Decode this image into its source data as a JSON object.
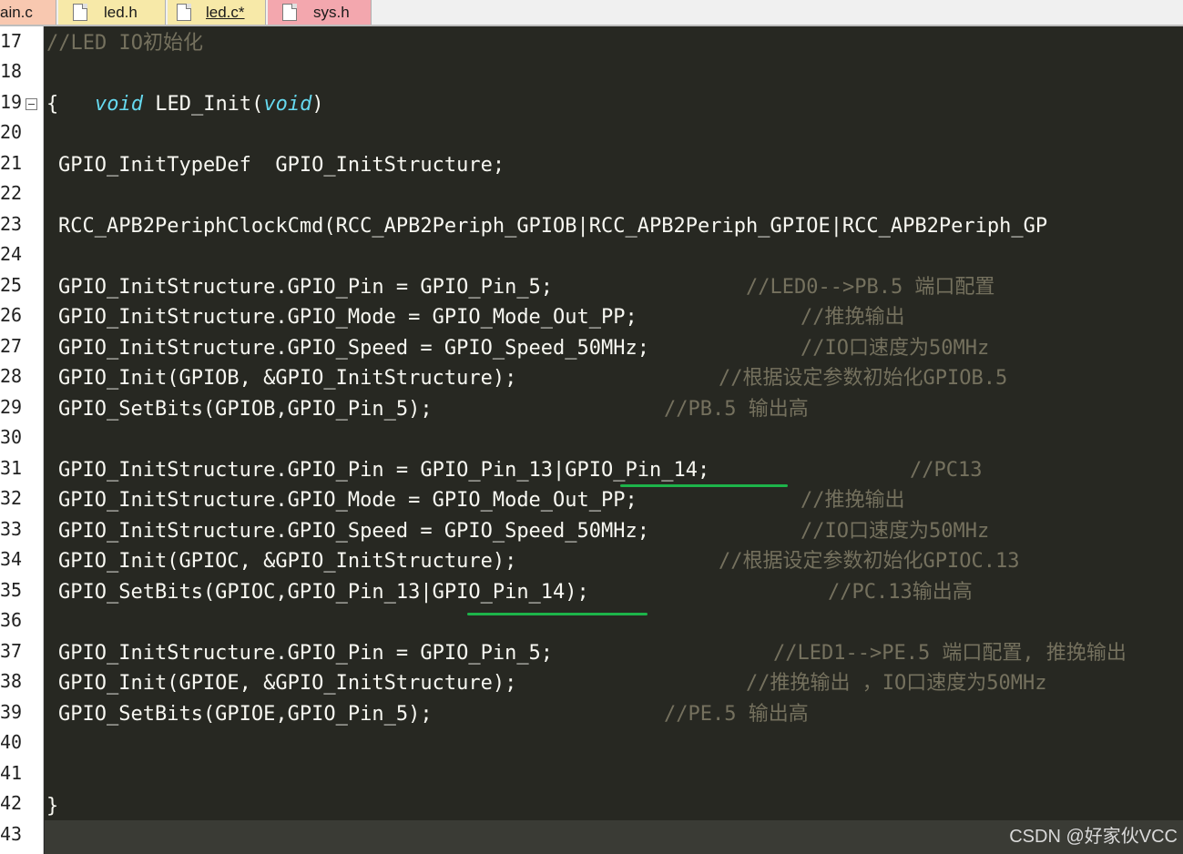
{
  "tabs": [
    {
      "label": "ain.c",
      "color": "#f8c8b0"
    },
    {
      "label": "led.h",
      "color": "#f7e9a8"
    },
    {
      "label": "led.c*",
      "color": "#f7e9a8",
      "active": true
    },
    {
      "label": "sys.h",
      "color": "#f3a7ae"
    }
  ],
  "line_numbers": [
    "17",
    "18",
    "19",
    "20",
    "21",
    "22",
    "23",
    "24",
    "25",
    "26",
    "27",
    "28",
    "29",
    "30",
    "31",
    "32",
    "33",
    "34",
    "35",
    "36",
    "37",
    "38",
    "39",
    "40",
    "41",
    "42",
    "43"
  ],
  "code": {
    "l17_comment": "//LED IO初始化",
    "l18_kw1": "void",
    "l18_mid": " LED_Init(",
    "l18_kw2": "void",
    "l18_end": ")",
    "l19": "{",
    "l21": "GPIO_InitTypeDef  GPIO_InitStructure;",
    "l23": "RCC_APB2PeriphClockCmd(RCC_APB2Periph_GPIOB|RCC_APB2Periph_GPIOE|RCC_APB2Periph_GP",
    "l25_code": "GPIO_InitStructure.GPIO_Pin = GPIO_Pin_5;",
    "l25_comment": "//LED0-->PB.5 端口配置",
    "l26_code": "GPIO_InitStructure.GPIO_Mode = GPIO_Mode_Out_PP;",
    "l26_comment": "//推挽输出",
    "l27_code": "GPIO_InitStructure.GPIO_Speed = GPIO_Speed_50MHz;",
    "l27_comment": "//IO口速度为50MHz",
    "l28_code": "GPIO_Init(GPIOB, &GPIO_InitStructure);",
    "l28_comment": "//根据设定参数初始化GPIOB.5",
    "l29_code": "GPIO_SetBits(GPIOB,GPIO_Pin_5);",
    "l29_comment": "//PB.5 输出高",
    "l31_code": "GPIO_InitStructure.GPIO_Pin = GPIO_Pin_13|GPIO_Pin_14;",
    "l31_comment": "//PC13",
    "l32_code": "GPIO_InitStructure.GPIO_Mode = GPIO_Mode_Out_PP;",
    "l32_comment": "//推挽输出",
    "l33_code": "GPIO_InitStructure.GPIO_Speed = GPIO_Speed_50MHz;",
    "l33_comment": "//IO口速度为50MHz",
    "l34_code": "GPIO_Init(GPIOC, &GPIO_InitStructure);",
    "l34_comment": "//根据设定参数初始化GPIOC.13",
    "l35_code": "GPIO_SetBits(GPIOC,GPIO_Pin_13|GPIO_Pin_14);",
    "l35_comment": "//PC.13输出高",
    "l37_code": "GPIO_InitStructure.GPIO_Pin = GPIO_Pin_5;",
    "l37_comment": "//LED1-->PE.5 端口配置, 推挽输出",
    "l38_code": "GPIO_Init(GPIOE, &GPIO_InitStructure);",
    "l38_comment": "//推挽输出 ，IO口速度为50MHz",
    "l39_code": "GPIO_SetBits(GPIOE,GPIO_Pin_5);",
    "l39_comment": "//PE.5 输出高",
    "l42": "}"
  },
  "watermark": "CSDN @好家伙VCC",
  "colors": {
    "background": "#272822",
    "comment": "#75715e",
    "keyword": "#66d9ef",
    "underline": "#1db44a"
  }
}
